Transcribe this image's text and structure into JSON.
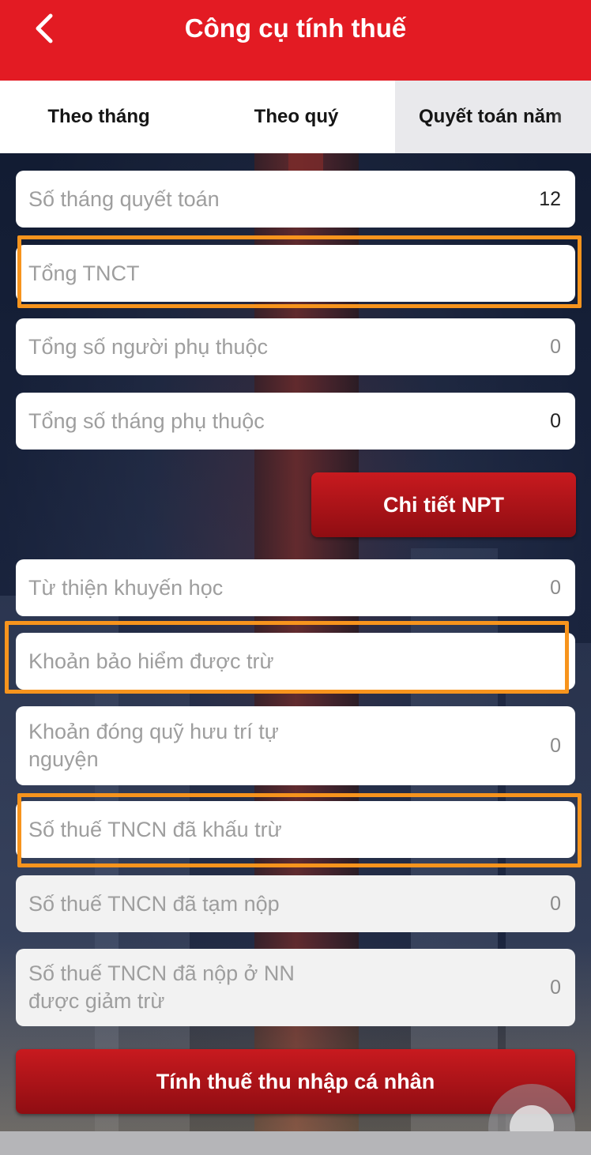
{
  "header": {
    "title": "Công cụ tính thuế",
    "back_icon": "chevron-left-icon",
    "background": "#e31b23"
  },
  "tabs": [
    {
      "label": "Theo tháng"
    },
    {
      "label": "Theo quý"
    },
    {
      "label": "Quyết toán năm",
      "selected": true
    }
  ],
  "fields": [
    {
      "label": "Số tháng quyết toán",
      "value": "12"
    },
    {
      "label": "Tổng TNCT",
      "value": "",
      "highlighted": true
    },
    {
      "label": "Tổng số người phụ thuộc",
      "value": "0"
    },
    {
      "label": "Tổng số tháng phụ thuộc",
      "value": "0"
    },
    {
      "label": "Từ thiện khuyến học",
      "value": "0"
    },
    {
      "label": "Khoản bảo hiểm được trừ",
      "value": "",
      "highlighted": true
    },
    {
      "label": "Khoản đóng quỹ hưu trí tự nguyện",
      "value": "0"
    },
    {
      "label": "Số thuế TNCN đã khấu trừ",
      "value": "",
      "highlighted": true
    },
    {
      "label": "Số thuế TNCN đã tạm nộp",
      "value": "0"
    },
    {
      "label": "Số thuế TNCN đã nộp ở NN được giảm trừ",
      "value": "0"
    }
  ],
  "buttons": {
    "dependents_detail": "Chi tiết NPT",
    "calculate": "Tính thuế thu nhập cá nhân"
  },
  "colors": {
    "accent": "#e31b23",
    "highlight_border": "#f7941d"
  }
}
